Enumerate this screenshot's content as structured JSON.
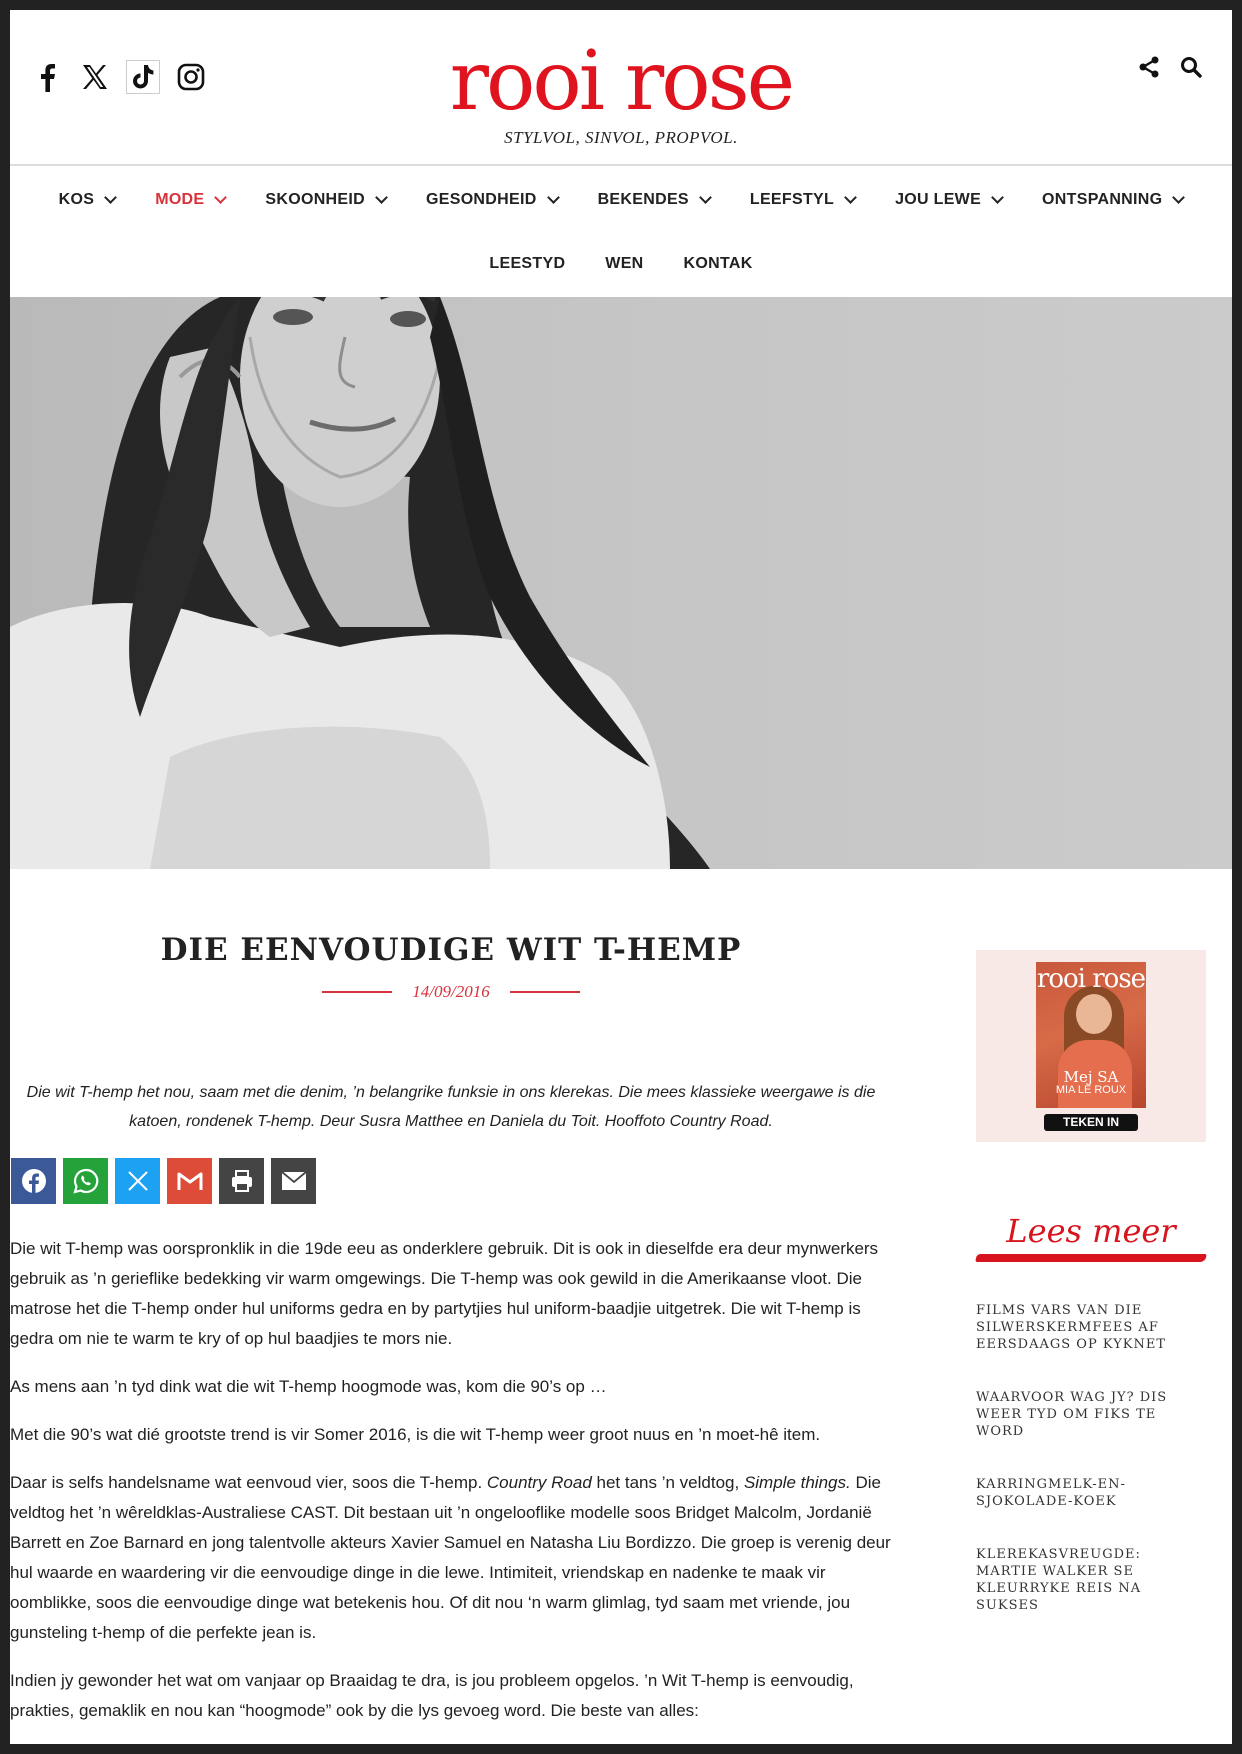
{
  "header": {
    "logo": "rooi rose",
    "tagline": "STYLVOL, SINVOL, PROPVOL."
  },
  "nav": {
    "row1": [
      {
        "label": "KOS"
      },
      {
        "label": "MODE"
      },
      {
        "label": "SKOONHEID"
      },
      {
        "label": "GESONDHEID"
      },
      {
        "label": "BEKENDES"
      },
      {
        "label": "LEEFSTYL"
      },
      {
        "label": "JOU LEWE"
      },
      {
        "label": "ONTSPANNING"
      }
    ],
    "row2": [
      {
        "label": "LEESTYD"
      },
      {
        "label": "WEN"
      },
      {
        "label": "KONTAK"
      }
    ],
    "active_color": "#d8323b"
  },
  "article": {
    "title": "DIE EENVOUDIGE WIT T-HEMP",
    "date": "14/09/2016",
    "intro": "Die wit T-hemp het nou, saam met die denim, ’n belangrike funksie in ons klerekas. Die mees klassieke weergawe is die katoen, rondenek T-hemp. Deur Susra Matthee en Daniela du Toit. Hooffoto Country Road.",
    "paragraphs": [
      "Die wit T-hemp was oorspronklik in die 19de eeu as onderklere gebruik. Dit is ook in dieselfde era deur mynwerkers gebruik as ’n gerieflike bedekking vir warm omgewings. Die T-hemp was ook gewild in die Amerikaanse vloot. Die matrose het die T-hemp onder hul uniforms gedra en by partytjies hul uniform-baadjie uitgetrek. Die wit T-hemp is gedra om nie te warm te kry of op hul baadjies te mors nie.",
      "As mens aan ’n tyd dink wat die wit T-hemp hoogmode was, kom die 90’s op …",
      "Met die 90’s wat dié grootste trend is vir Somer 2016, is die wit T-hemp weer groot nuus en ’n moet-hê item."
    ],
    "p4": {
      "a": "Daar is selfs handelsname wat eenvoud vier, soos die T-hemp. ",
      "b": "Country Road",
      "c": " het tans ’n veldtog, ",
      "d": "Simple things.",
      "e": " Die veldtog het ’n wêreldklas-Australiese CAST. Dit bestaan uit ’n ongelooflike modelle soos Bridget Malcolm, Jordanië Barrett en Zoe Barnard en jong talentvolle akteurs Xavier Samuel en Natasha Liu Bordizzo. Die groep is verenig deur hul waarde en waardering vir die eenvoudige dinge in die lewe.  Intimiteit, vriendskap en nadenke te maak vir oomblikke, soos die eenvoudige dinge wat betekenis hou. Of dit nou ‘n warm glimlag, tyd saam met vriende, jou gunsteling t-hemp of die perfekte jean is."
    },
    "p5": "Indien jy gewonder het wat om vanjaar op Braaidag te dra, is jou probleem opgelos. ’n Wit T-hemp is eenvoudig, prakties, gemaklik en nou kan “hoogmode” ook by die lys gevoeg word. Die beste van alles:"
  },
  "share_buttons": [
    {
      "icon": "facebook-icon",
      "color": "#3b5998"
    },
    {
      "icon": "whatsapp-icon",
      "color": "#25a23a"
    },
    {
      "icon": "x-icon",
      "color": "#1da1f2"
    },
    {
      "icon": "gmail-icon",
      "color": "#dd4b39"
    },
    {
      "icon": "print-icon",
      "color": "#444444"
    },
    {
      "icon": "email-icon",
      "color": "#444444"
    }
  ],
  "sidebar": {
    "cover": {
      "logo": "rooi rose",
      "name": "Mej SA",
      "name2": "MIA LE ROUX"
    },
    "subscribe": "TEKEN IN",
    "lees_meer": "Lees meer",
    "related": [
      "FILMS VARS VAN DIE SILWERSKERMFEES AF EERSDAAGS OP KYKNET",
      "WAARVOOR WAG JY? DIS WEER TYD OM FIKS TE WORD",
      "KARRINGMELK-EN-SJOKOLADE-KOEK",
      "KLEREKASVREUGDE: MARTIE WALKER SE KLEURRYKE REIS NA SUKSES"
    ]
  },
  "colors": {
    "brand_red": "#e0141e",
    "accent_red": "#d8323b"
  }
}
